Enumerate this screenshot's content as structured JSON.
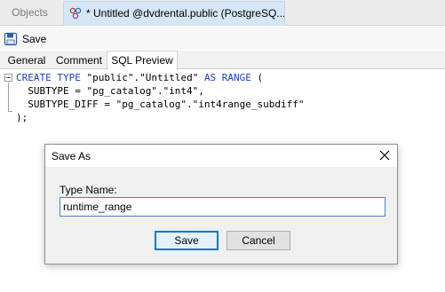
{
  "tabs": {
    "objects": "Objects",
    "editor": "* Untitled @dvdrental.public (PostgreSQ..."
  },
  "toolbar": {
    "save_label": "Save"
  },
  "subtabs": {
    "general": "General",
    "comment": "Comment",
    "sql_preview": "SQL Preview"
  },
  "sql": {
    "line1_kw1": "CREATE TYPE",
    "line1_name": " \"public\".\"Untitled\" ",
    "line1_kw2": "AS RANGE",
    "line1_end": " (",
    "line2": "  SUBTYPE = \"pg_catalog\".\"int4\",",
    "line3": "  SUBTYPE_DIFF = \"pg_catalog\".\"int4range_subdiff\"",
    "line4": ");"
  },
  "dialog": {
    "title": "Save As",
    "field_label": "Type Name:",
    "field_value": "runtime_range",
    "save_button": "Save",
    "cancel_button": "Cancel"
  },
  "colors": {
    "keyword": "#1a42c8",
    "active_tab": "#d6e6f5",
    "default_button_border": "#0078d7"
  }
}
